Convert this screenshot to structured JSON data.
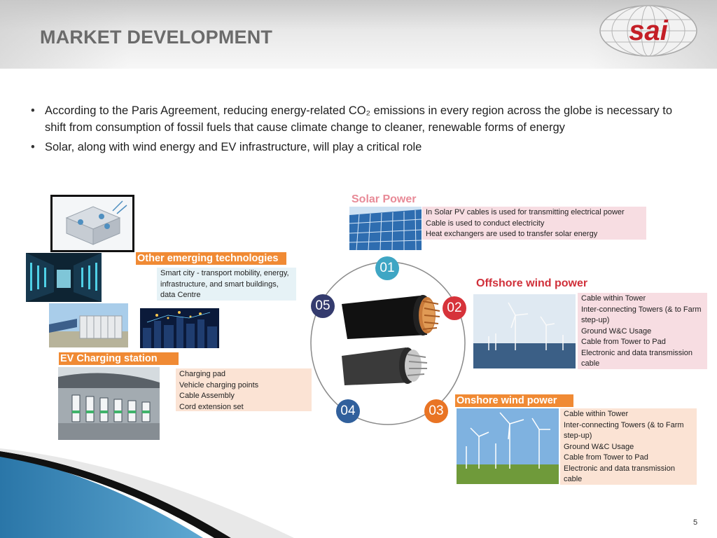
{
  "header": {
    "title": "MARKET DEVELOPMENT",
    "logo_text": "sai"
  },
  "bullets": [
    "According to the Paris Agreement, reducing energy-related CO₂ emissions in every region across the globe is necessary to shift from consumption of fossil fuels that cause climate change to cleaner, renewable forms of energy",
    "Solar, along with wind energy and EV infrastructure, will play a critical role"
  ],
  "diagram": {
    "numbers": [
      "01",
      "02",
      "03",
      "04",
      "05"
    ]
  },
  "solar": {
    "title": "Solar Power",
    "lines": [
      "In Solar PV cables is used for transmitting electrical power",
      "Cable is used to conduct electricity",
      "Heat exchangers are used to transfer solar energy"
    ]
  },
  "offshore": {
    "title": "Offshore wind power",
    "lines": [
      "Cable within Tower",
      "Inter-connecting Towers (& to Farm step-up)",
      "Ground W&C Usage",
      "Cable from Tower to Pad",
      "Electronic and data transmission cable"
    ]
  },
  "onshore": {
    "title": "Onshore wind power",
    "lines": [
      "Cable within Tower",
      "Inter-connecting Towers (& to Farm step-up)",
      "Ground W&C Usage",
      "Cable from Tower to Pad",
      "Electronic and data transmission cable"
    ]
  },
  "emerging": {
    "title": "Other emerging technologies",
    "text": "Smart city - transport mobility, energy, infrastructure, and smart buildings, data Centre"
  },
  "ev": {
    "title": "EV Charging station",
    "lines": [
      "Charging pad",
      "Vehicle charging points",
      "Cable Assembly",
      "Cord extension set"
    ]
  },
  "page_number": "5",
  "colors": {
    "title_gray": "#6b6b6b",
    "accent_orange": "#f08a34",
    "accent_red": "#d0303a",
    "accent_pink": "#e88a97",
    "logo_red": "#c41e26"
  }
}
